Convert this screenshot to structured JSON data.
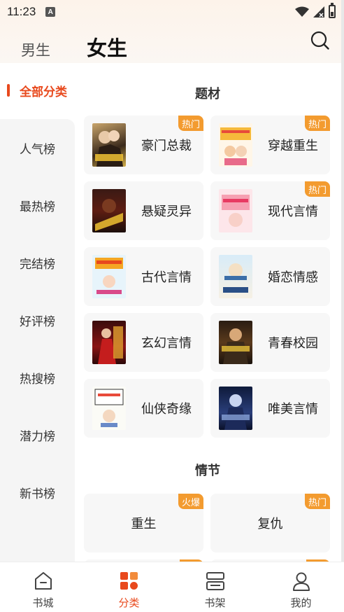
{
  "status_bar": {
    "time": "11:23",
    "notification_badge": "A"
  },
  "header": {
    "tab_male": "男生",
    "tab_female": "女生",
    "search_icon": "search-icon"
  },
  "sidebar": {
    "active": "全部分类",
    "items": [
      {
        "label": "人气榜"
      },
      {
        "label": "最热榜"
      },
      {
        "label": "完结榜"
      },
      {
        "label": "好评榜"
      },
      {
        "label": "热搜榜"
      },
      {
        "label": "潜力榜"
      },
      {
        "label": "新书榜"
      }
    ]
  },
  "sections": {
    "theme": {
      "title": "题材",
      "items": [
        {
          "name": "豪门总裁",
          "tag": "热门"
        },
        {
          "name": "穿越重生",
          "tag": "热门"
        },
        {
          "name": "悬疑灵异",
          "tag": ""
        },
        {
          "name": "现代言情",
          "tag": "热门"
        },
        {
          "name": "古代言情",
          "tag": ""
        },
        {
          "name": "婚恋情感",
          "tag": ""
        },
        {
          "name": "玄幻言情",
          "tag": ""
        },
        {
          "name": "青春校园",
          "tag": ""
        },
        {
          "name": "仙侠奇缘",
          "tag": ""
        },
        {
          "name": "唯美言情",
          "tag": ""
        }
      ]
    },
    "plot": {
      "title": "情节",
      "items": [
        {
          "name": "重生",
          "tag": "火爆"
        },
        {
          "name": "复仇",
          "tag": "热门"
        }
      ]
    }
  },
  "bottom_nav": {
    "items": [
      {
        "label": "书城",
        "icon": "home-icon"
      },
      {
        "label": "分类",
        "icon": "category-icon"
      },
      {
        "label": "书架",
        "icon": "bookshelf-icon"
      },
      {
        "label": "我的",
        "icon": "profile-icon"
      }
    ],
    "active_index": 1
  },
  "colors": {
    "accent": "#e8491d",
    "tag": "#f39b2f",
    "card": "#f7f7f7"
  }
}
